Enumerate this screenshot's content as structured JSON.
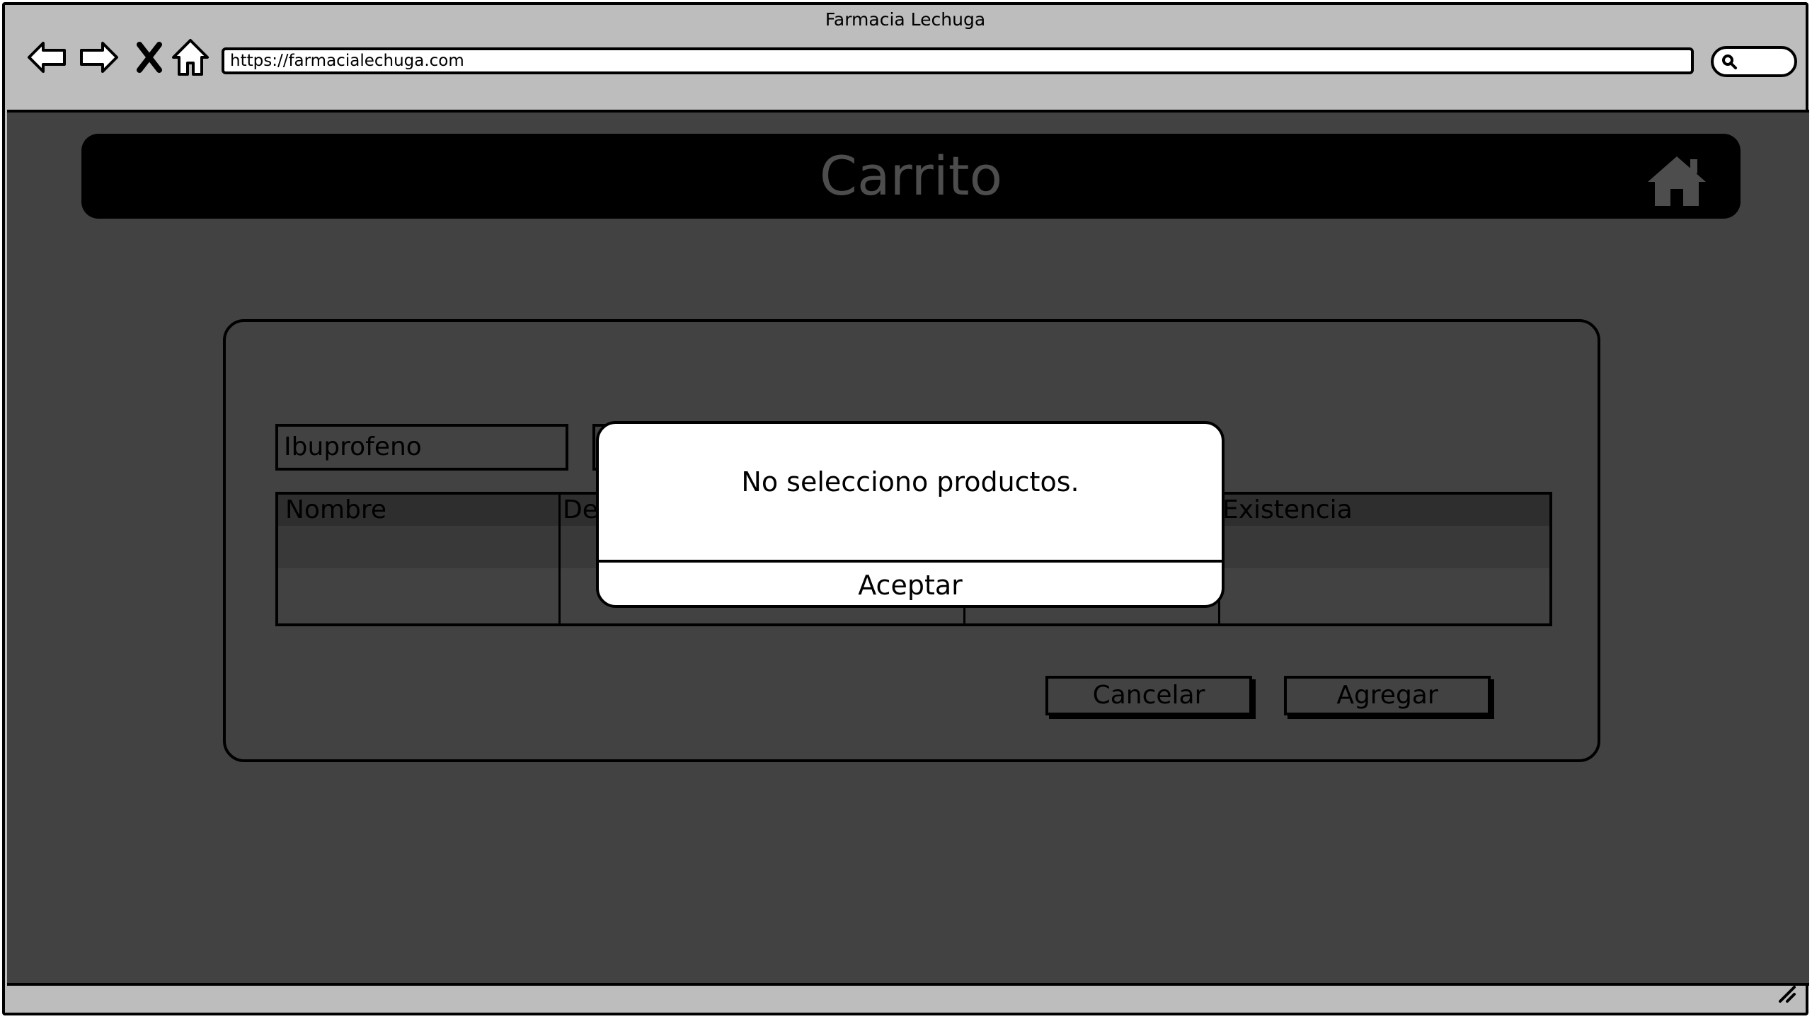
{
  "browser": {
    "title": "Farmacia Lechuga",
    "url": "https://farmacialechuga.com",
    "nav_icons": [
      "back-arrow-icon",
      "forward-arrow-icon",
      "close-icon",
      "home-icon"
    ],
    "search_icon": "search-icon"
  },
  "header": {
    "title": "Carrito",
    "home_icon": "home-icon"
  },
  "search": {
    "value": "Ibuprofeno"
  },
  "table": {
    "columns": [
      "Nombre",
      "De",
      "",
      "Existencia"
    ],
    "rows": []
  },
  "buttons": {
    "cancel": "Cancelar",
    "add": "Agregar"
  },
  "modal": {
    "message": "No selecciono productos.",
    "accept": "Aceptar"
  }
}
